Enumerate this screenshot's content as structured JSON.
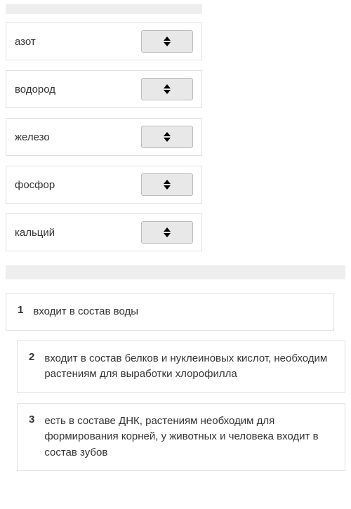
{
  "matchItems": [
    {
      "label": "азот"
    },
    {
      "label": "водород"
    },
    {
      "label": "железо"
    },
    {
      "label": "фосфор"
    },
    {
      "label": "кальций"
    }
  ],
  "answers": [
    {
      "number": "1",
      "text": "входит в состав воды"
    },
    {
      "number": "2",
      "text": "входит в состав белков и нуклеиновых кислот, необходим растениям для выработки хлорофилла"
    },
    {
      "number": "3",
      "text": "есть в составе ДНК, растениям необходим для формирования корней, у животных и человека входит в состав зубов"
    }
  ]
}
